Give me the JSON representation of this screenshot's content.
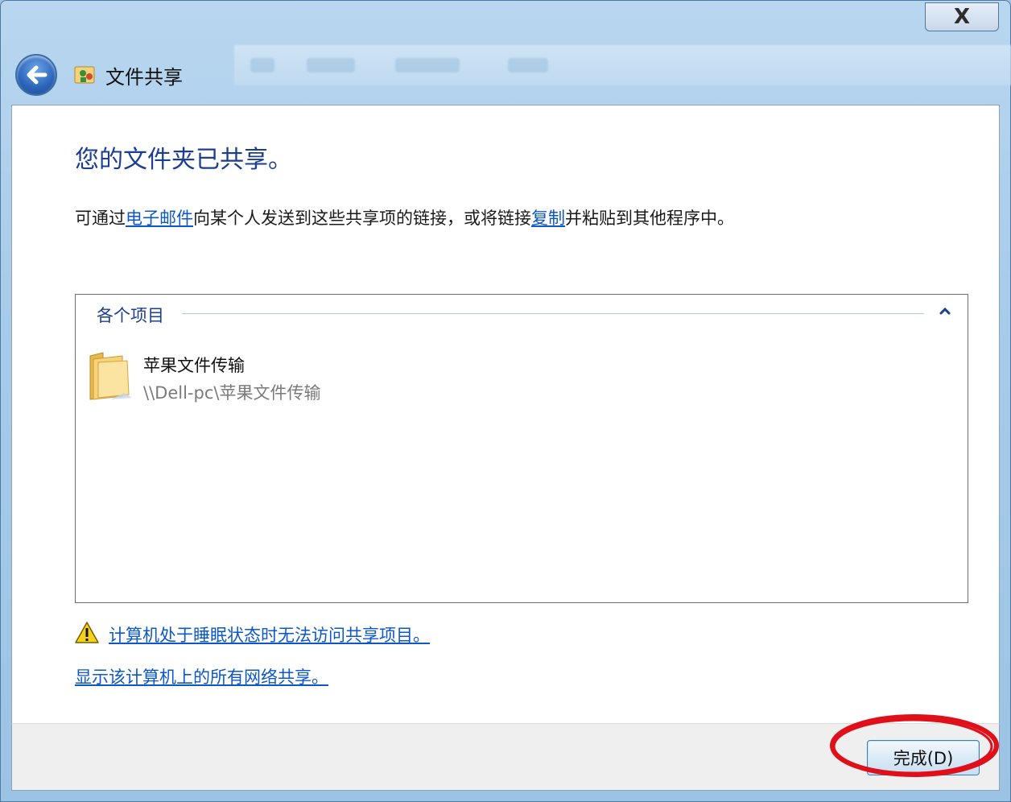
{
  "window": {
    "title": "文件共享",
    "close_label": "X"
  },
  "main": {
    "heading": "您的文件夹已共享。",
    "desc_prefix": "可通过",
    "email_link": "电子邮件",
    "desc_middle": "向某个人发送到这些共享项的链接，或将链接",
    "copy_link": "复制",
    "desc_suffix": "并粘贴到其他程序中。"
  },
  "items_panel": {
    "group_label": "各个项目",
    "items": [
      {
        "name": "苹果文件传输",
        "path": "\\\\Dell-pc\\苹果文件传输"
      }
    ]
  },
  "links": {
    "sleep_warning": "计算机处于睡眠状态时无法访问共享项目。",
    "show_all_shares": "显示该计算机上的所有网络共享。"
  },
  "footer": {
    "done_label": "完成(D)"
  },
  "colors": {
    "link": "#0c58c8",
    "heading": "#1b3e8f",
    "highlight": "#e0101a"
  },
  "icons": [
    "back-arrow-icon",
    "file-sharing-icon",
    "chevron-up-icon",
    "folder-icon",
    "warning-icon",
    "close-icon"
  ]
}
